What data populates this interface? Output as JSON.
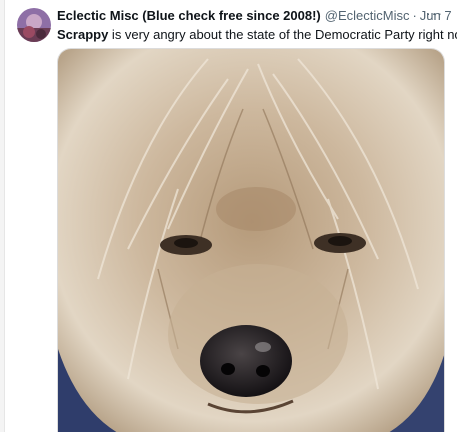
{
  "tweet": {
    "author_name": "Eclectic Misc (Blue check free since 2008!)",
    "author_handle": "@EclecticMisc",
    "separator": "·",
    "timestamp": "Jun 7",
    "more_label": "···",
    "text_bold": "Scrappy",
    "text_rest": " is very angry about the state of the Democratic Party right now.",
    "media_icon": "dog-photo",
    "avatar_icon": "avatar-image"
  }
}
